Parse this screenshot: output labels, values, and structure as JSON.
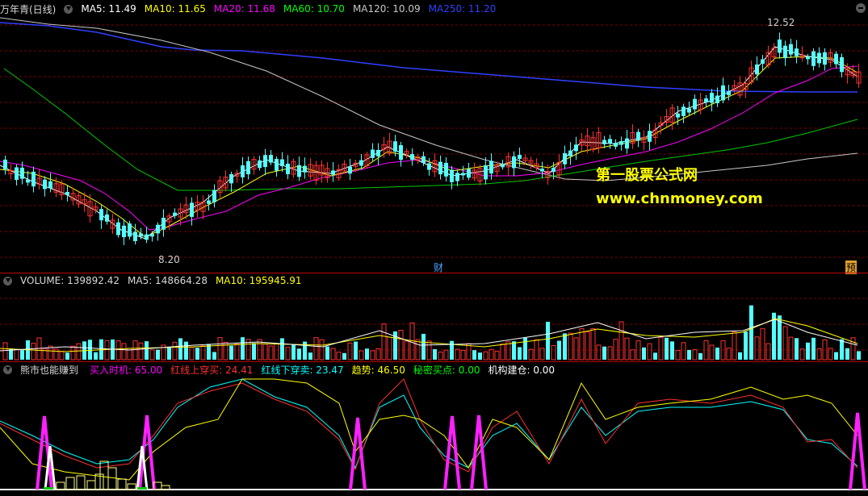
{
  "main_panel": {
    "title": "万年青(日线)",
    "ma_items": [
      {
        "label": "MA5: 11.49",
        "color": "#ffffff"
      },
      {
        "label": "MA10: 11.65",
        "color": "#ffff00"
      },
      {
        "label": "MA20: 11.68",
        "color": "#ff00ff"
      },
      {
        "label": "MA60: 10.70",
        "color": "#00ff00"
      },
      {
        "label": "MA120: 10.09",
        "color": "#c8c8c8"
      },
      {
        "label": "MA250: 11.20",
        "color": "#3040ff"
      }
    ],
    "high_label": "12.52",
    "low_label": "8.20",
    "cai_marker": "财",
    "yu_marker": "预",
    "watermark_cn": "第一股票公式网",
    "watermark_url": "www.chnmoney.com"
  },
  "volume_panel": {
    "items": [
      {
        "label": "VOLUME: 139892.42",
        "color": "#d8d8d8"
      },
      {
        "label": "MA5: 148664.28",
        "color": "#d8d8d8"
      },
      {
        "label": "MA10: 195945.91",
        "color": "#ffff00"
      }
    ]
  },
  "indicator_panel": {
    "title": "熊市也能赚到",
    "items": [
      {
        "label": "买入时机: 65.00",
        "color": "#ff00ff"
      },
      {
        "label": "红线上穿买: 24.41",
        "color": "#ff3030"
      },
      {
        "label": "红线下穿卖: 23.47",
        "color": "#00ffff"
      },
      {
        "label": "趋势: 46.50",
        "color": "#ffff00"
      },
      {
        "label": "秘密买点: 0.00",
        "color": "#00ff00"
      },
      {
        "label": "机构建仓: 0.00",
        "color": "#ffffff"
      }
    ]
  },
  "colors": {
    "up": "#ff3232",
    "down": "#54ffff",
    "grid": "#7a0000",
    "separator": "#b00000"
  }
}
